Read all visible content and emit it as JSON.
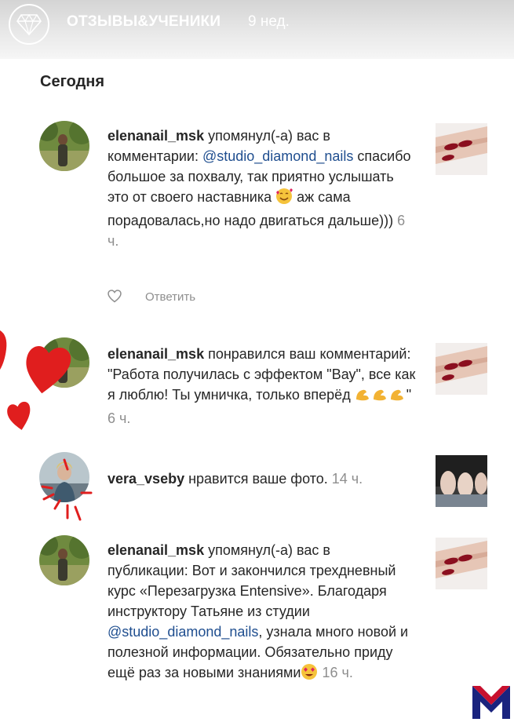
{
  "story": {
    "account_name": "ОТЗЫВЫ&УЧЕНИКИ",
    "time_ago": "9 нед."
  },
  "section_title": "Сегодня",
  "notifications": [
    {
      "username": "elenanail_msk",
      "action": " упомянул(-а) вас в комментарии: ",
      "mention": "@studio_diamond_nails",
      "text_before_emoji": " спасибо большое за похвалу, так приятно услышать это от своего наставника ",
      "emoji": "smiling-face-with-hearts",
      "text_after_emoji": " аж сама порадовалась,но надо двигаться дальше)))",
      "time": "6 ч.",
      "reply_label": "Ответить"
    },
    {
      "username": "elenanail_msk",
      "action": " понравился ваш комментарий: ",
      "text": "\"Работа получилась с эффектом \"Вау\", все как я люблю! Ты умничка, только вперёд ",
      "emoji": "flexed-biceps",
      "text_after_emoji": "\"",
      "time": "6 ч."
    },
    {
      "username": "vera_vseby",
      "action": " нравится ваше фото.",
      "time": "14 ч."
    },
    {
      "username": "elenanail_msk",
      "action": " упомянул(-а) вас в публикации: ",
      "text_before_mention": "Вот и закончился трехдневный курс «Перезагрузка Entensive». Благодаря инструктору Татьяне из студии ",
      "mention": "@studio_diamond_nails",
      "text_after_mention": ", узнала много новой и полезной информации. Обязательно приду ещё раз за новыми знаниями",
      "emoji": "smiling-face-with-heart-eyes",
      "time": "16 ч."
    }
  ],
  "colors": {
    "mention_blue": "#1f4e8f",
    "secondary_gray": "#8e8e8e",
    "nail_red": "#8b0f1f",
    "heart_red": "#e01e1e",
    "brand_red": "#c8102e",
    "brand_blue": "#1a237e"
  },
  "icons": [
    "diamond-icon",
    "heart-outline-icon",
    "red-heart-sticker",
    "brand-m-logo"
  ]
}
